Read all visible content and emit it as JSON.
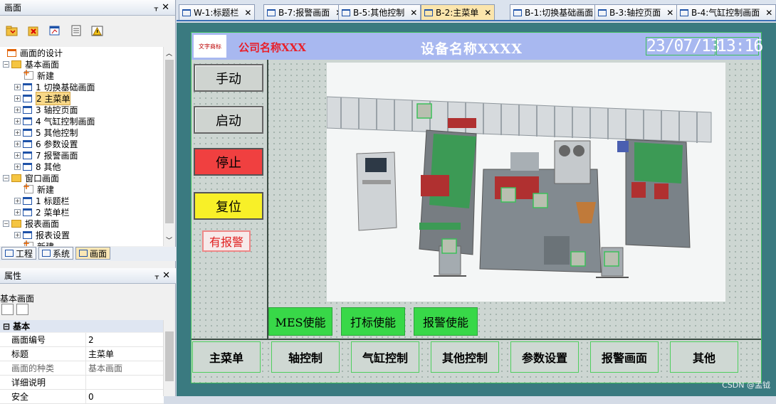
{
  "left_panel": {
    "title": "画面",
    "pin": "ᚁ",
    "close": "✕",
    "tree": [
      {
        "label": "画面的设计",
        "kind": "root"
      },
      {
        "label": "基本画面",
        "kind": "folder"
      },
      {
        "label": "新建",
        "kind": "new"
      },
      {
        "label": "1 切换基础画面",
        "kind": "page"
      },
      {
        "label": "2 主菜单",
        "kind": "page",
        "selected": true
      },
      {
        "label": "3 轴控页面",
        "kind": "page"
      },
      {
        "label": "4 气缸控制画面",
        "kind": "page"
      },
      {
        "label": "5 其他控制",
        "kind": "page"
      },
      {
        "label": "6 参数设置",
        "kind": "page"
      },
      {
        "label": "7 报警画面",
        "kind": "page"
      },
      {
        "label": "8 其他",
        "kind": "page"
      },
      {
        "label": "窗口画面",
        "kind": "folder"
      },
      {
        "label": "新建",
        "kind": "new"
      },
      {
        "label": "1 标题栏",
        "kind": "page"
      },
      {
        "label": "2 菜单栏",
        "kind": "page"
      },
      {
        "label": "报表画面",
        "kind": "folder"
      },
      {
        "label": "报表设置",
        "kind": "page"
      },
      {
        "label": "新建",
        "kind": "new"
      }
    ],
    "bottom_tabs": [
      "工程",
      "系统",
      "画面"
    ]
  },
  "properties": {
    "title": "属性",
    "object": "基本画面",
    "section": "基本",
    "rows": [
      {
        "key": "画面编号",
        "value": "2"
      },
      {
        "key": "标题",
        "value": "主菜单"
      },
      {
        "key": "画面的种类",
        "value": "基本画面",
        "gray": true
      },
      {
        "key": "详细说明",
        "value": ""
      },
      {
        "key": "安全",
        "value": "0"
      }
    ]
  },
  "doc_tabs": [
    {
      "label": "W-1:标题栏"
    },
    {
      "label": "B-7:报警画面"
    },
    {
      "label": "B-5:其他控制"
    },
    {
      "label": "B-2:主菜单",
      "active": true
    },
    {
      "label": "B-1:切换基础画面"
    },
    {
      "label": "B-3:轴控页面"
    },
    {
      "label": "B-4:气缸控制画面"
    }
  ],
  "hmi": {
    "logo": "文字商标",
    "company": "公司名称XXX",
    "device": "设备名称XXXX",
    "date": "23/07/13",
    "time": "13:16",
    "side_buttons": [
      "手动",
      "启动",
      "停止",
      "复位"
    ],
    "alarm": "有报警",
    "enable_buttons": [
      "MES使能",
      "打标使能",
      "报警使能"
    ],
    "nav_buttons": [
      "主菜单",
      "轴控制",
      "气缸控制",
      "其他控制",
      "参数设置",
      "报警画面",
      "其他"
    ]
  },
  "watermark": "CSDN @孟钺",
  "colors": {
    "work_bg": "#3a7a80",
    "header": "#a8b8f0",
    "green": "#38d848",
    "red": "#f04040",
    "yellow": "#f8f028"
  }
}
